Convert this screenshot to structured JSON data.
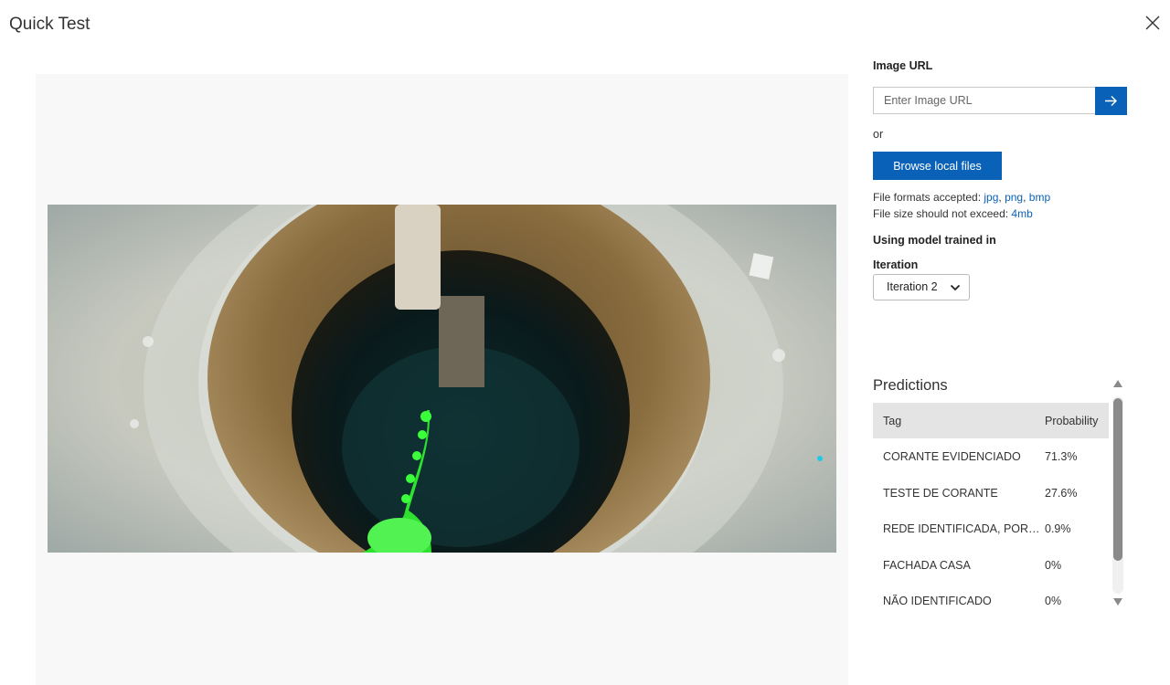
{
  "header": {
    "title": "Quick Test",
    "close_icon": "close-icon"
  },
  "side": {
    "image_url_label": "Image URL",
    "image_url_placeholder": "Enter Image URL",
    "submit_icon": "arrow-right-icon",
    "or_label": "or",
    "browse_label": "Browse local files",
    "formats_prefix": "File formats accepted: ",
    "formats": [
      "jpg",
      "png",
      "bmp"
    ],
    "size_prefix": "File size should not exceed: ",
    "size_limit": "4mb",
    "model_label": "Using model trained in",
    "iteration_label": "Iteration",
    "iteration_selected": "Iteration 2"
  },
  "predictions": {
    "title": "Predictions",
    "columns": {
      "tag": "Tag",
      "probability": "Probability"
    },
    "rows": [
      {
        "tag": "CORANTE EVIDENCIADO",
        "probability": "71.3%"
      },
      {
        "tag": "TESTE DE CORANTE",
        "probability": "27.6%"
      },
      {
        "tag": "REDE IDENTIFICADA, PORÉM …",
        "probability": "0.9%"
      },
      {
        "tag": "FACHADA CASA",
        "probability": "0%"
      },
      {
        "tag": "NÃO IDENTIFICADO",
        "probability": "0%"
      }
    ]
  },
  "colors": {
    "accent": "#0a62b8",
    "table_header": "#e4e4e4",
    "preview_bg": "#f8f8f8"
  }
}
